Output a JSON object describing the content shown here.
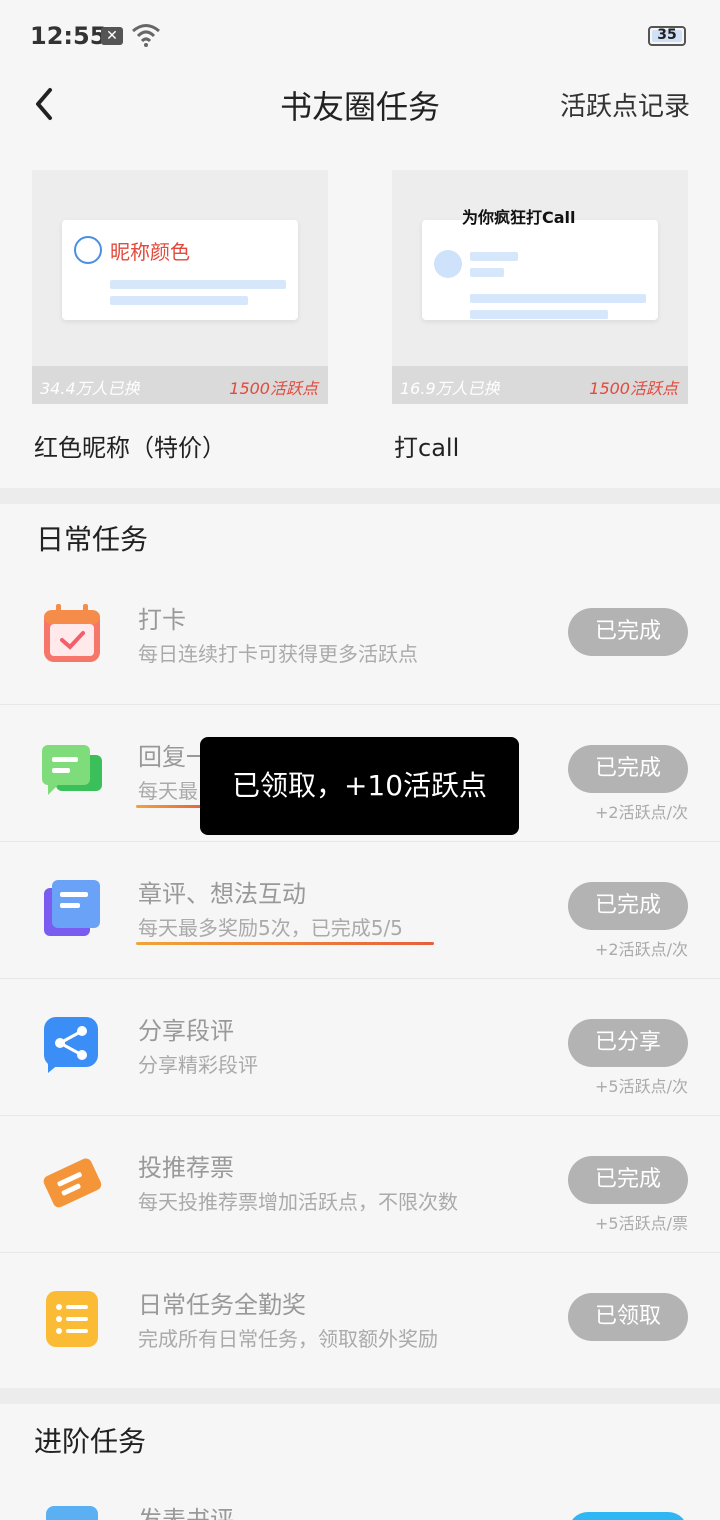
{
  "status_bar": {
    "time": "12:55",
    "notif": "✕",
    "battery": "35"
  },
  "nav": {
    "title": "书友圈任务",
    "record": "活跃点记录"
  },
  "rewards": [
    {
      "name": "红色昵称（特价）",
      "people": "34.4万人已换",
      "cost": "1500活跃点",
      "preview_label": "昵称颜色"
    },
    {
      "name": "打call",
      "people": "16.9万人已换",
      "cost": "1500活跃点",
      "preview_label": "为你疯狂打Call"
    }
  ],
  "daily": {
    "title": "日常任务",
    "tasks": [
      {
        "name": "打卡",
        "desc": "每日连续打卡可获得更多活跃点",
        "button": "已完成",
        "reward": ""
      },
      {
        "name": "回复一",
        "desc": "每天最",
        "button": "已完成",
        "reward": "+2活跃点/次"
      },
      {
        "name": "章评、想法互动",
        "desc": "每天最多奖励5次，已完成5/5",
        "button": "已完成",
        "reward": "+2活跃点/次"
      },
      {
        "name": "分享段评",
        "desc": "分享精彩段评",
        "button": "已分享",
        "reward": "+5活跃点/次"
      },
      {
        "name": "投推荐票",
        "desc": "每天投推荐票增加活跃点，不限次数",
        "button": "已完成",
        "reward": "+5活跃点/票"
      },
      {
        "name": "日常任务全勤奖",
        "desc": "完成所有日常任务，领取额外奖励",
        "button": "已领取",
        "reward": ""
      }
    ]
  },
  "advanced": {
    "title": "进阶任务",
    "first_task": "发表书评"
  },
  "toast": "已领取，+10活跃点",
  "colors": {
    "accent_red": "#e34a3c",
    "button_gray": "#b3b3b3",
    "advanced_btn": "#2fb6f5"
  }
}
